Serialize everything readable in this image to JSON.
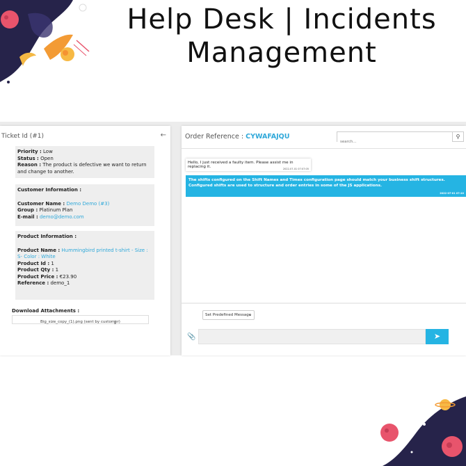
{
  "header": {
    "title_line1": "Help Desk | Incidents",
    "title_line2": "Management"
  },
  "ticket": {
    "heading": "Ticket Id (#1)",
    "priority_label": "Priority :",
    "priority_value": "Low",
    "status_label": "Status :",
    "status_value": "Open",
    "reason_label": "Reason :",
    "reason_value": "The product is defective we want to return and change to another."
  },
  "customer": {
    "section_title": "Customer Information :",
    "name_label": "Customer Name :",
    "name_value": "Demo Demo (#3)",
    "group_label": "Group :",
    "group_value": "Platinum Plan",
    "email_label": "E-mail :",
    "email_value": "demo@demo.com"
  },
  "product": {
    "section_title": "Product Information :",
    "name_label": "Product Name :",
    "name_value": "Hummingbird printed t-shirt - Size : S- Color : White",
    "id_label": "Product Id :",
    "id_value": "1",
    "qty_label": "Product Qty :",
    "qty_value": "1",
    "price_label": "Product Price :",
    "price_value": "€23.90",
    "ref_label": "Reference :",
    "ref_value": "demo_1"
  },
  "attachments": {
    "title": "Download Attachments :",
    "file": "Big_size_copy_(1).png (sent by customer)"
  },
  "order": {
    "label": "Order Reference :",
    "code": "CYWAFAJQU"
  },
  "search": {
    "placeholder": "search..."
  },
  "messages": [
    {
      "text": "Hello, I just received a faulty item. Please assist me in replacing it.",
      "time": "2022-07-01 07:07:05"
    },
    {
      "text": "The shifts configured on the Shift Names and Times configuration page should match your business shift structures. Configured shifts are used to structure and order entries in some of the JS applications.",
      "time": "2022-07-01 07:10"
    }
  ],
  "composer": {
    "predefined_label": "Set Predefined Message"
  },
  "colors": {
    "accent": "#25b4e3",
    "link": "#2fa8d9"
  }
}
